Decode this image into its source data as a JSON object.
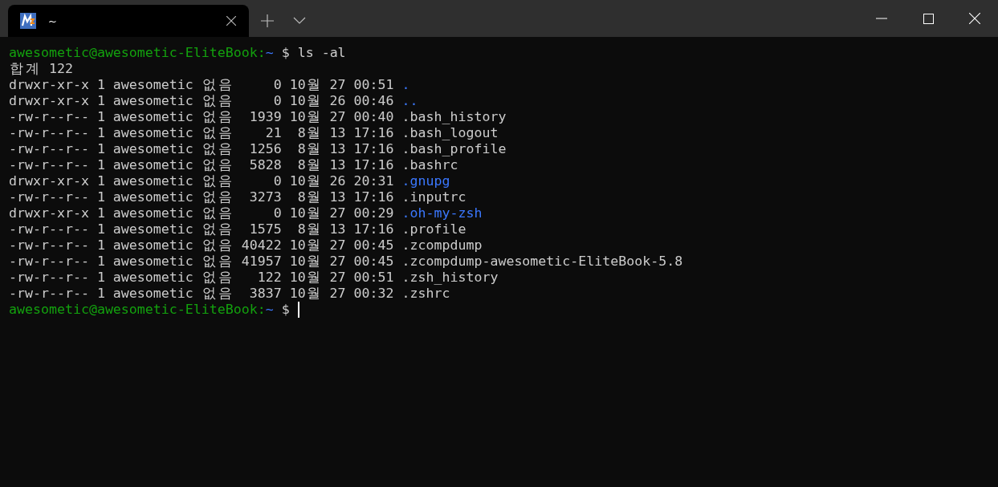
{
  "window": {
    "tabs": [
      {
        "title": "~",
        "selected": true
      }
    ]
  },
  "terminal": {
    "lines": [
      {
        "kind": "prompt",
        "user_host": "awesometic@awesometic-EliteBook:",
        "path": "~",
        "symbol": "$",
        "command": "ls -al"
      },
      {
        "kind": "plain",
        "text": "합계 122"
      },
      {
        "kind": "entry",
        "text": "drwxr-xr-x 1 awesometic 없음     0 10월 27 00:51",
        "filename": ".",
        "directory": true
      },
      {
        "kind": "entry",
        "text": "drwxr-xr-x 1 awesometic 없음     0 10월 26 00:46",
        "filename": "..",
        "directory": true
      },
      {
        "kind": "entry",
        "text": "-rw-r--r-- 1 awesometic 없음  1939 10월 27 00:40",
        "filename": ".bash_history",
        "directory": false
      },
      {
        "kind": "entry",
        "text": "-rw-r--r-- 1 awesometic 없음    21  8월 13 17:16",
        "filename": ".bash_logout",
        "directory": false
      },
      {
        "kind": "entry",
        "text": "-rw-r--r-- 1 awesometic 없음  1256  8월 13 17:16",
        "filename": ".bash_profile",
        "directory": false
      },
      {
        "kind": "entry",
        "text": "-rw-r--r-- 1 awesometic 없음  5828  8월 13 17:16",
        "filename": ".bashrc",
        "directory": false
      },
      {
        "kind": "entry",
        "text": "drwxr-xr-x 1 awesometic 없음     0 10월 26 20:31",
        "filename": ".gnupg",
        "directory": true
      },
      {
        "kind": "entry",
        "text": "-rw-r--r-- 1 awesometic 없음  3273  8월 13 17:16",
        "filename": ".inputrc",
        "directory": false
      },
      {
        "kind": "entry",
        "text": "drwxr-xr-x 1 awesometic 없음     0 10월 27 00:29",
        "filename": ".oh-my-zsh",
        "directory": true
      },
      {
        "kind": "entry",
        "text": "-rw-r--r-- 1 awesometic 없음  1575  8월 13 17:16",
        "filename": ".profile",
        "directory": false
      },
      {
        "kind": "entry",
        "text": "-rw-r--r-- 1 awesometic 없음 40422 10월 27 00:45",
        "filename": ".zcompdump",
        "directory": false
      },
      {
        "kind": "entry",
        "text": "-rw-r--r-- 1 awesometic 없음 41957 10월 27 00:45",
        "filename": ".zcompdump-awesometic-EliteBook-5.8",
        "directory": false
      },
      {
        "kind": "entry",
        "text": "-rw-r--r-- 1 awesometic 없음   122 10월 27 00:51",
        "filename": ".zsh_history",
        "directory": false
      },
      {
        "kind": "entry",
        "text": "-rw-r--r-- 1 awesometic 없음  3837 10월 27 00:32",
        "filename": ".zshrc",
        "directory": false
      },
      {
        "kind": "prompt",
        "user_host": "awesometic@awesometic-EliteBook:",
        "path": "~",
        "symbol": "$",
        "cursor": true
      }
    ]
  }
}
